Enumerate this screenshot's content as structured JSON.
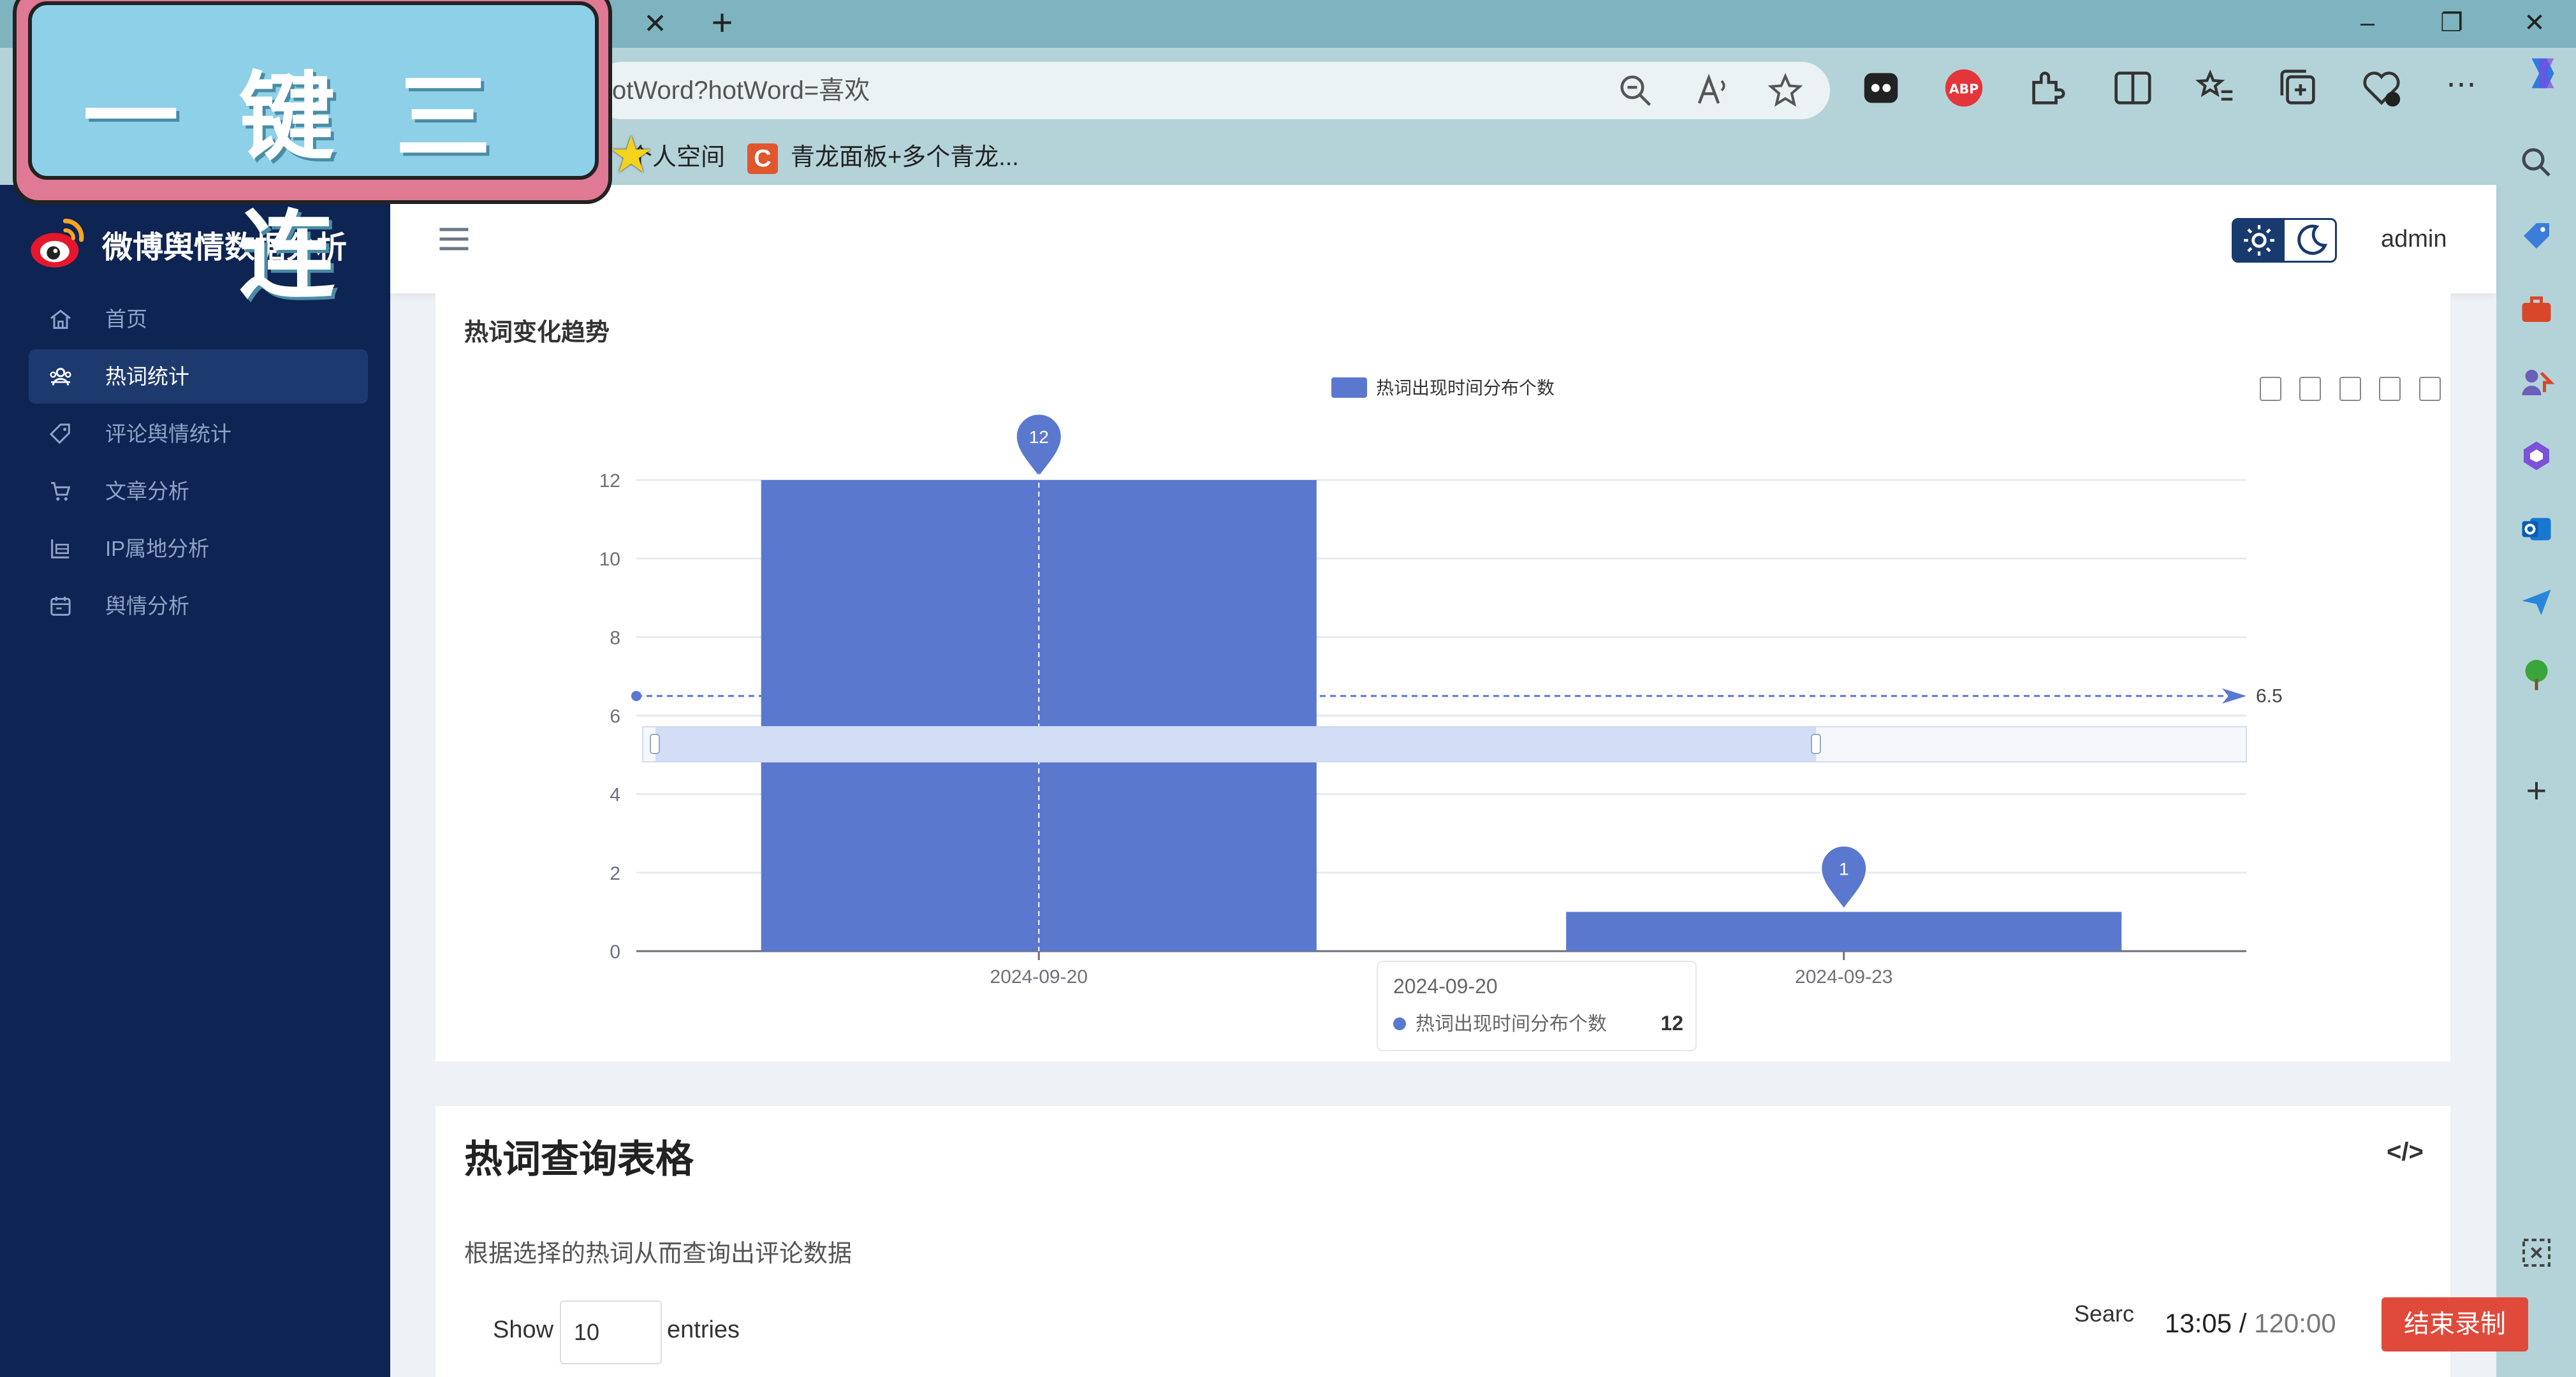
{
  "browser": {
    "url": "otWord?hotWord=喜欢",
    "bookmarks": [
      "个人空间",
      "青龙面板+多个青龙..."
    ],
    "bookmark_icon_letter": "C",
    "new_tab_symbol": "+",
    "close_tab_symbol": "✕"
  },
  "overlay": {
    "text": "一键三连"
  },
  "app": {
    "brand": "微博舆情数据分析",
    "nav": [
      {
        "label": "首页",
        "icon": "home-icon",
        "active": false
      },
      {
        "label": "热词统计",
        "icon": "users-icon",
        "active": true
      },
      {
        "label": "评论舆情统计",
        "icon": "tag-icon",
        "active": false
      },
      {
        "label": "文章分析",
        "icon": "cart-icon",
        "active": false
      },
      {
        "label": "IP属地分析",
        "icon": "chart-box-icon",
        "active": false
      },
      {
        "label": "舆情分析",
        "icon": "calendar-icon",
        "active": false
      }
    ],
    "user": "admin"
  },
  "chart_card": {
    "title": "热词变化趋势"
  },
  "chart_data": {
    "type": "bar",
    "categories": [
      "2024-09-20",
      "2024-09-23"
    ],
    "series": [
      {
        "name": "热词出现时间分布个数",
        "values": [
          12,
          1
        ],
        "color": "#5b78cf"
      }
    ],
    "ylim": [
      0,
      12
    ],
    "yticks": [
      0,
      2,
      4,
      6,
      8,
      10,
      12
    ],
    "mark_points": [
      12,
      1
    ],
    "mark_line": {
      "label": "6.5",
      "value": 6.5
    },
    "legend_position": "top-center",
    "grid": true,
    "tooltip": {
      "title": "2024-09-20",
      "series": "热词出现时间分布个数",
      "value": "12"
    }
  },
  "table_card": {
    "title": "热词查询表格",
    "code_toggle": "</>",
    "description": "根据选择的热词从而查询出评论数据",
    "show_label": "Show",
    "length_value": "10",
    "entries_label": "entries",
    "search_label": "Searc"
  },
  "recorder": {
    "elapsed": "13:05",
    "total": "120:00",
    "separator": "/",
    "stop_label": "结束录制"
  },
  "colors": {
    "sidebar": "#0e2452",
    "bar": "#5b78cf",
    "stop_button": "#e04a3b"
  }
}
